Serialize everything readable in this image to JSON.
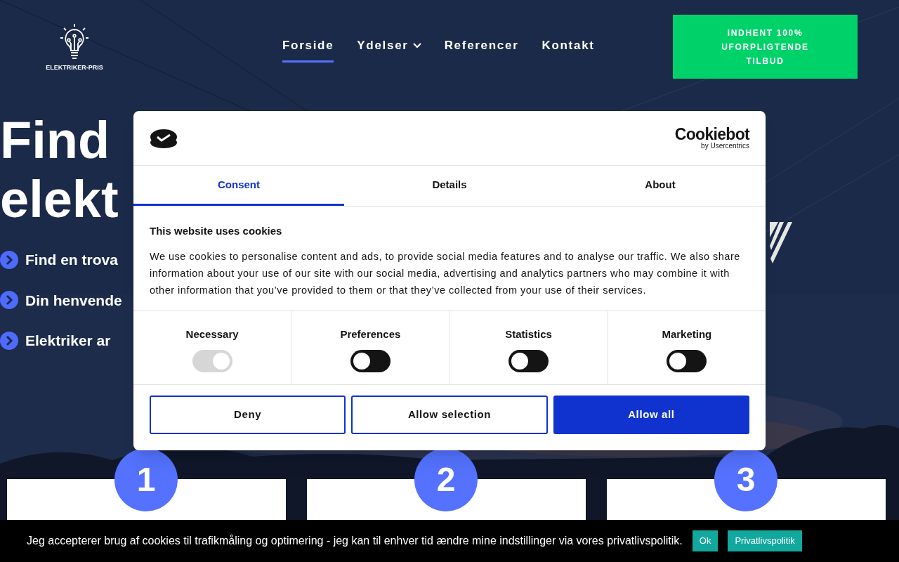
{
  "header": {
    "logo_text": "ELEKTRIKER-PRIS",
    "nav": [
      {
        "label": "Forside",
        "selected": true,
        "dropdown": false
      },
      {
        "label": "Ydelser",
        "selected": false,
        "dropdown": true
      },
      {
        "label": "Referencer",
        "selected": false,
        "dropdown": false
      },
      {
        "label": "Kontakt",
        "selected": false,
        "dropdown": false
      }
    ],
    "cta": "INDHENT 100% UFORPLIGTENDE TILBUD"
  },
  "hero": {
    "heading_lines": [
      "Find",
      "elekt"
    ],
    "bullets": [
      "Find en trova",
      "Din henvende",
      "Elektriker ar"
    ]
  },
  "steps": [
    "1",
    "2",
    "3"
  ],
  "cookie_dialog": {
    "brand": "Cookiebot",
    "brand_sub": "by Usercentrics",
    "tabs": [
      {
        "label": "Consent",
        "selected": true
      },
      {
        "label": "Details",
        "selected": false
      },
      {
        "label": "About",
        "selected": false
      }
    ],
    "title": "This website uses cookies",
    "body": "We use cookies to personalise content and ads, to provide social media features and to analyse our traffic. We also share information about your use of our site with our social media, advertising and analytics partners who may combine it with other information that you’ve provided to them or that they’ve collected from your use of their services.",
    "categories": [
      {
        "label": "Necessary",
        "on": true,
        "disabled": true
      },
      {
        "label": "Preferences",
        "on": false,
        "disabled": false
      },
      {
        "label": "Statistics",
        "on": false,
        "disabled": false
      },
      {
        "label": "Marketing",
        "on": false,
        "disabled": false
      }
    ],
    "buttons": [
      {
        "label": "Deny",
        "kind": "outline"
      },
      {
        "label": "Allow selection",
        "kind": "outline"
      },
      {
        "label": "Allow all",
        "kind": "filled"
      }
    ]
  },
  "cookie_bar": {
    "text": "Jeg accepterer brug af cookies til trafikmåling og optimering - jeg kan til enhver tid ændre mine indstillinger via vores privatlivspolitik.",
    "buttons": [
      "Ok",
      "Privatlivspolitik"
    ]
  }
}
